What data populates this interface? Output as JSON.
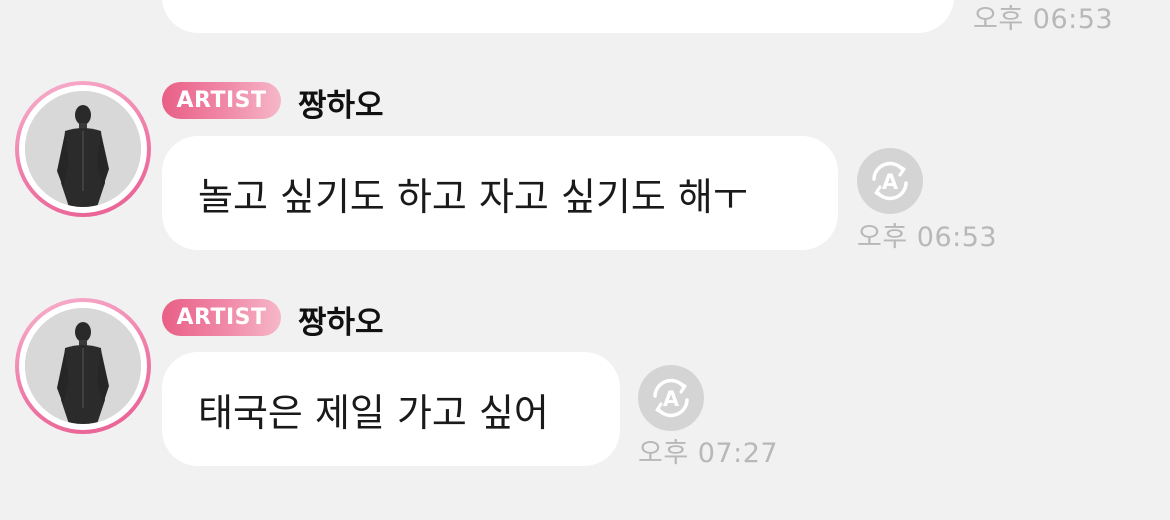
{
  "messages": [
    {
      "time": "오후 06:53"
    },
    {
      "badge": "ARTIST",
      "sender": "짱하오",
      "text": "놀고 싶기도 하고 자고 싶기도 해ㅜ",
      "time": "오후 06:53",
      "translate_icon": "translate-icon"
    },
    {
      "badge": "ARTIST",
      "sender": "짱하오",
      "text": "태국은 제일 가고 싶어",
      "time": "오후 07:27",
      "translate_icon": "translate-icon"
    }
  ],
  "colors": {
    "background": "#f1f1f1",
    "bubble": "#ffffff",
    "badge_start": "#e95f86",
    "badge_end": "#f6b7c9",
    "timestamp": "#b8b8b8",
    "translate_button": "#d4d4d4"
  }
}
